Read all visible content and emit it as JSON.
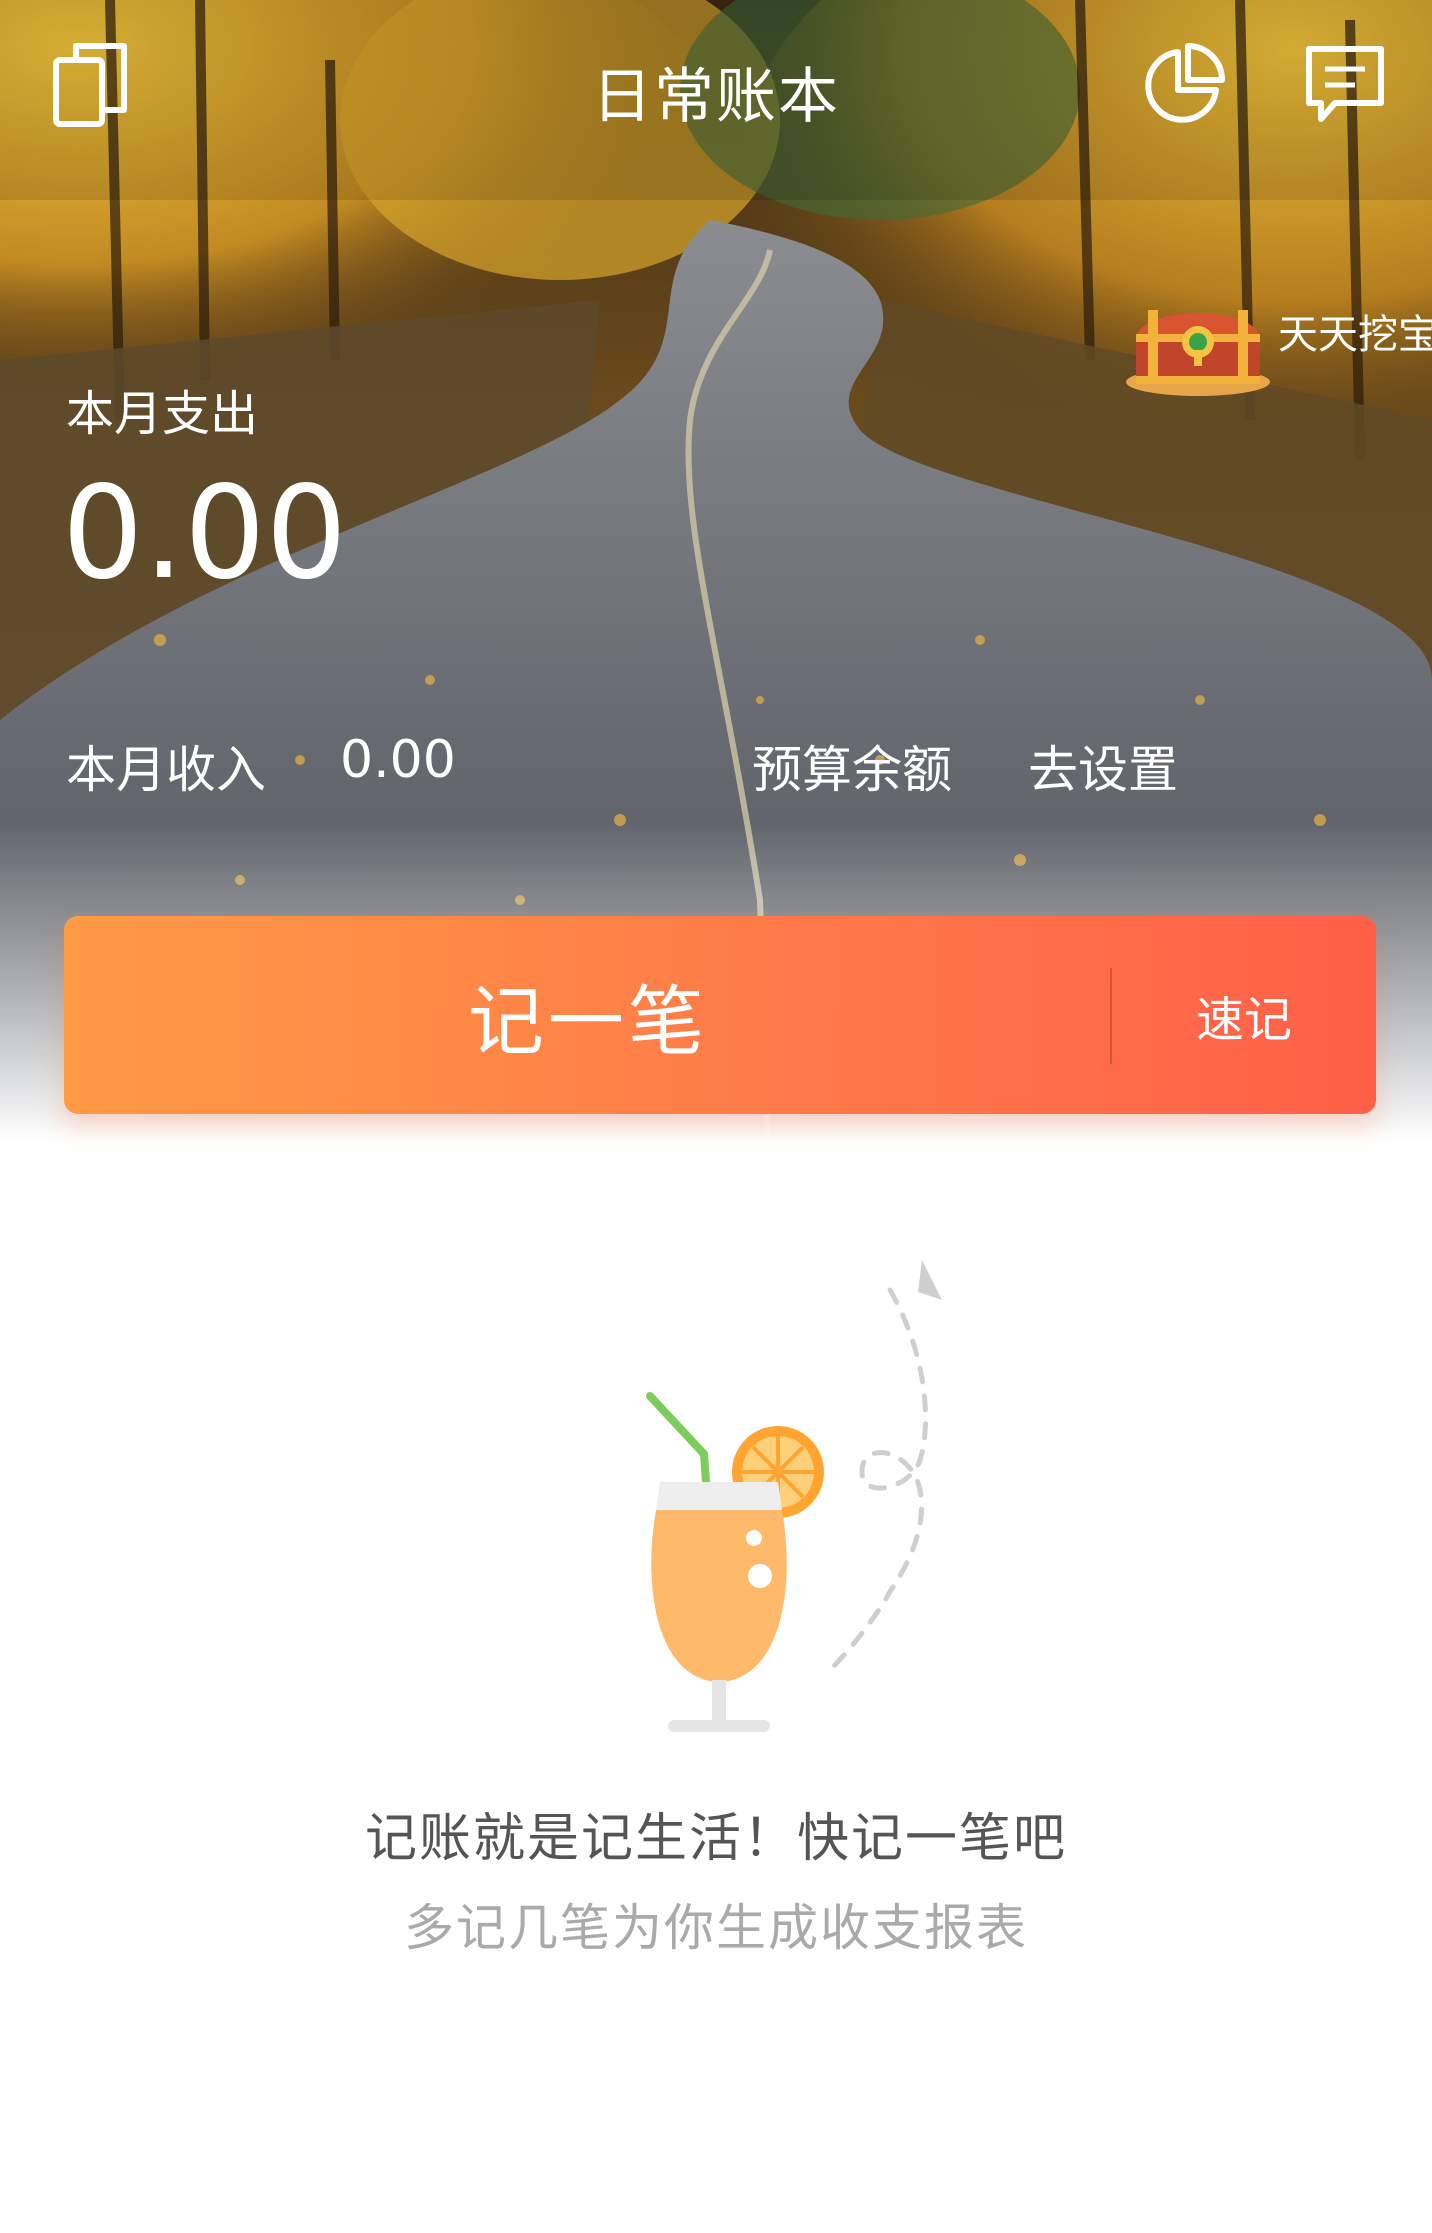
{
  "header": {
    "title": "日常账本",
    "left_icon": "ledger-switch-icon",
    "right_icons": [
      "pie-chart-icon",
      "message-icon"
    ]
  },
  "promo": {
    "label": "天天挖宝",
    "icon": "treasure-chest-icon"
  },
  "summary": {
    "expense_label": "本月支出",
    "expense_value": "0.00",
    "income_label": "本月收入",
    "income_value": "0.00",
    "budget_label": "预算余额",
    "budget_action": "去设置"
  },
  "actions": {
    "record_label": "记一笔",
    "quick_label": "速记"
  },
  "empty_state": {
    "illustration": "juice-glass-icon",
    "title": "记账就是记生活！快记一笔吧",
    "subtitle": "多记几笔为你生成收支报表"
  },
  "colors": {
    "accent_start": "#ff9a45",
    "accent_end": "#ff5f48",
    "text_primary": "#555555",
    "text_secondary": "#aaaaaa"
  }
}
